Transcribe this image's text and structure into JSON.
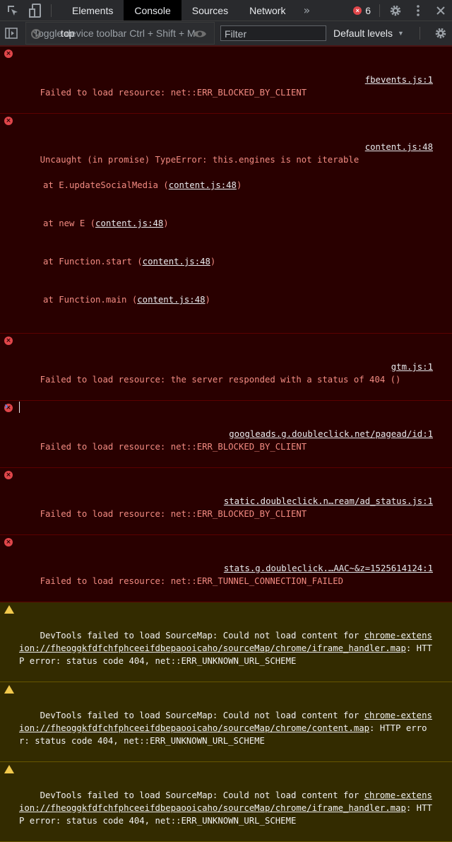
{
  "topbar": {
    "inspect_icon": "inspect-element-icon",
    "device_icon": "device-toolbar-icon",
    "tabs": [
      {
        "label": "Elements",
        "active": false
      },
      {
        "label": "Console",
        "active": true
      },
      {
        "label": "Sources",
        "active": false
      },
      {
        "label": "Network",
        "active": false
      }
    ],
    "more_tabs_label": "»",
    "error_count": "6",
    "error_icon_glyph": "×",
    "settings_icon": "gear-icon",
    "menu_icon": "kebab-menu-icon",
    "close_icon": "close-icon"
  },
  "console_toolbar": {
    "sidebar_icon": "show-console-sidebar-icon",
    "clear_icon": "clear-console-icon",
    "context": "top",
    "tooltip": "Toggle device toolbar  Ctrl + Shift + M",
    "eye_icon": "live-expression-eye-icon",
    "filter_placeholder": "Filter",
    "levels_label": "Default levels",
    "levels_caret": "▼",
    "settings_icon": "gear-icon"
  },
  "messages": [
    {
      "level": "error",
      "text": "Failed to load resource: net::ERR_BLOCKED_BY_CLIENT",
      "source": "fbevents.js:1"
    },
    {
      "level": "error",
      "text": "Uncaught (in promise) TypeError: this.engines is not iterable",
      "source": "content.js:48",
      "stack": [
        {
          "prefix": "at E.updateSocialMedia (",
          "link": "content.js:48",
          "suffix": ")"
        },
        {
          "prefix": "at new E (",
          "link": "content.js:48",
          "suffix": ")"
        },
        {
          "prefix": "at Function.start (",
          "link": "content.js:48",
          "suffix": ")"
        },
        {
          "prefix": "at Function.main (",
          "link": "content.js:48",
          "suffix": ")"
        }
      ]
    },
    {
      "level": "error",
      "text": "Failed to load resource: the server responded with a status of 404 ()",
      "source": "gtm.js:1"
    },
    {
      "level": "error",
      "text": "Failed to load resource: net::ERR_BLOCKED_BY_CLIENT",
      "source": "googleads.g.doubleclick.net/pagead/id:1"
    },
    {
      "level": "error",
      "text": "Failed to load resource: net::ERR_BLOCKED_BY_CLIENT",
      "source": "static.doubleclick.n…ream/ad_status.js:1"
    },
    {
      "level": "error",
      "text": "Failed to load resource: net::ERR_TUNNEL_CONNECTION_FAILED",
      "source": "stats.g.doubleclick.…AAC~&z=1525614124:1"
    },
    {
      "level": "warning",
      "prefix": "DevTools failed to load SourceMap: Could not load content for ",
      "link": "chrome-extension://fheoggkfdfchfphceeifdbepaooicaho/sourceMap/chrome/iframe_handler.map",
      "suffix": ": HTTP error: status code 404, net::ERR_UNKNOWN_URL_SCHEME"
    },
    {
      "level": "warning",
      "prefix": "DevTools failed to load SourceMap: Could not load content for ",
      "link": "chrome-extension://fheoggkfdfchfphceeifdbepaooicaho/sourceMap/chrome/content.map",
      "suffix": ": HTTP error: status code 404, net::ERR_UNKNOWN_URL_SCHEME"
    },
    {
      "level": "warning",
      "prefix": "DevTools failed to load SourceMap: Could not load content for ",
      "link": "chrome-extension://fheoggkfdfchfphceeifdbepaooicaho/sourceMap/chrome/iframe_handler.map",
      "suffix": ": HTTP error: status code 404, net::ERR_UNKNOWN_URL_SCHEME"
    }
  ],
  "prompt": {
    "chevron": "›",
    "value": ""
  },
  "colors": {
    "error_bg": "#290000",
    "error_text": "#f28b82",
    "warning_bg": "#332b00",
    "accent": "#4c8bf5",
    "error_badge": "#e0464a"
  }
}
